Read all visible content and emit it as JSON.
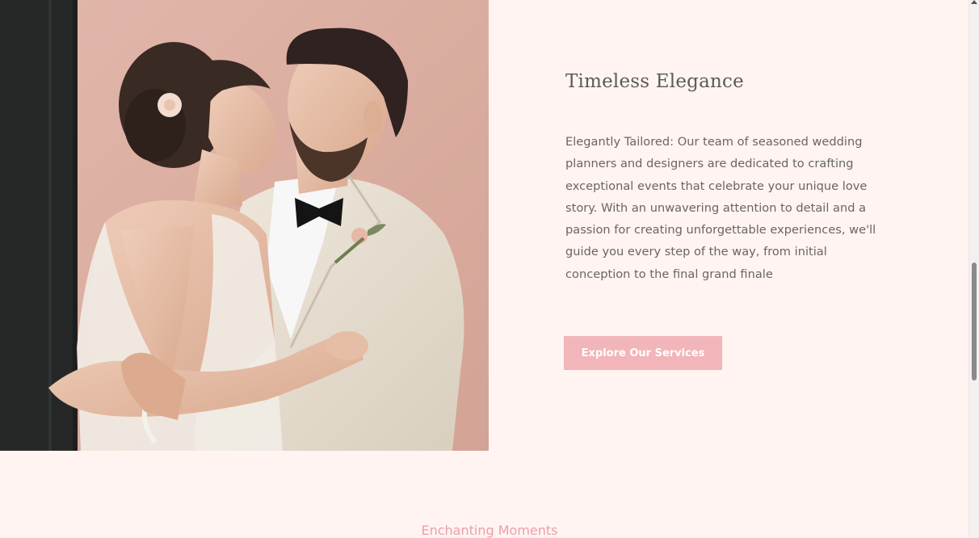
{
  "feature": {
    "image_alt": "Bride and groom embracing",
    "title": "Timeless Elegance",
    "body": "Elegantly Tailored: Our team of seasoned wedding planners and designers are dedicated to crafting exceptional events that celebrate your unique love story. With an unwavering attention to detail and a passion for creating unforgettable experiences, we'll guide you every step of the way, from initial conception to the final grand finale",
    "cta_label": "Explore Our Services"
  },
  "next_section": {
    "heading": "Enchanting Moments"
  },
  "colors": {
    "background": "#fff4f2",
    "accent": "#f2b5b9",
    "heading_accent": "#ee9ea6",
    "text": "#6a6562"
  }
}
